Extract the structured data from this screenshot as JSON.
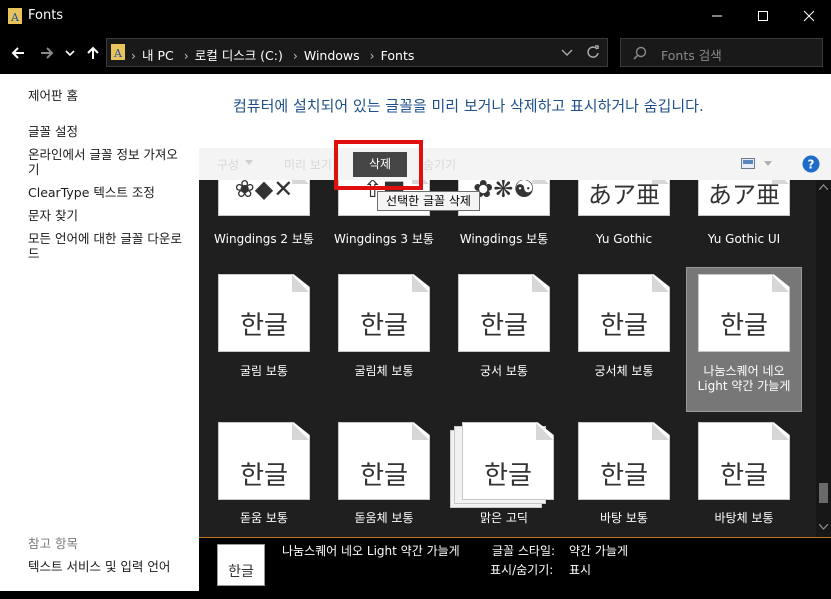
{
  "window": {
    "title": "Fonts"
  },
  "address": {
    "crumbs": [
      "내 PC",
      "로컬 디스크 (C:)",
      "Windows",
      "Fonts"
    ]
  },
  "search": {
    "placeholder": "Fonts 검색"
  },
  "sidebar": {
    "home": "제어판 홈",
    "links": [
      "글꼴 설정",
      "온라인에서 글꼴 정보 가져오기",
      "ClearType 텍스트 조정",
      "문자 찾기",
      "모든 언어에 대한 글꼴 다운로드"
    ],
    "see_also_heading": "참고 항목",
    "see_also": [
      "텍스트 서비스 및 입력 언어"
    ]
  },
  "main": {
    "headline": "컴퓨터에 설치되어 있는 글꼴을 미리 보거나 삭제하고 표시하거나 숨깁니다."
  },
  "toolbar": {
    "organize": "구성",
    "preview": "미리 보기",
    "delete": "삭제",
    "hide": "숨기기"
  },
  "tooltip": {
    "text": "선택한 글꼴 삭제"
  },
  "fonts": {
    "row1": [
      {
        "label": "Wingdings 2 보통",
        "glyph": "❀◆✕"
      },
      {
        "label": "Wingdings 3 보통",
        "glyph": "⇧■"
      },
      {
        "label": "Wingdings 보통",
        "glyph": "✿❋☯"
      },
      {
        "label": "Yu Gothic",
        "glyph": "あア亜"
      },
      {
        "label": "Yu Gothic UI",
        "glyph": "あア亜"
      }
    ],
    "row2": [
      {
        "label": "굴림 보통",
        "glyph": "한글"
      },
      {
        "label": "굴림체 보통",
        "glyph": "한글"
      },
      {
        "label": "궁서 보통",
        "glyph": "한글"
      },
      {
        "label": "궁서체 보통",
        "glyph": "한글"
      },
      {
        "label": "나눔스퀘어 네오 Light 약간 가늘게",
        "glyph": "한글"
      }
    ],
    "row3": [
      {
        "label": "돋움 보통",
        "glyph": "한글"
      },
      {
        "label": "돋움체 보통",
        "glyph": "한글"
      },
      {
        "label": "맑은 고딕",
        "glyph": "한글"
      },
      {
        "label": "바탕 보통",
        "glyph": "한글"
      },
      {
        "label": "바탕체 보통",
        "glyph": "한글"
      }
    ]
  },
  "details": {
    "name": "나눔스퀘어 네오 Light 약간 가늘게",
    "style_label": "글꼴 스타일:",
    "style_value": "약간 가늘게",
    "visibility_label": "표시/숨기기:",
    "visibility_value": "표시",
    "thumb_glyph": "한글"
  },
  "colors": {
    "selected_tile": "#777777",
    "grid_bg": "#1f1f1f",
    "headline": "#1e4f8a",
    "highlight": "#e01010"
  }
}
